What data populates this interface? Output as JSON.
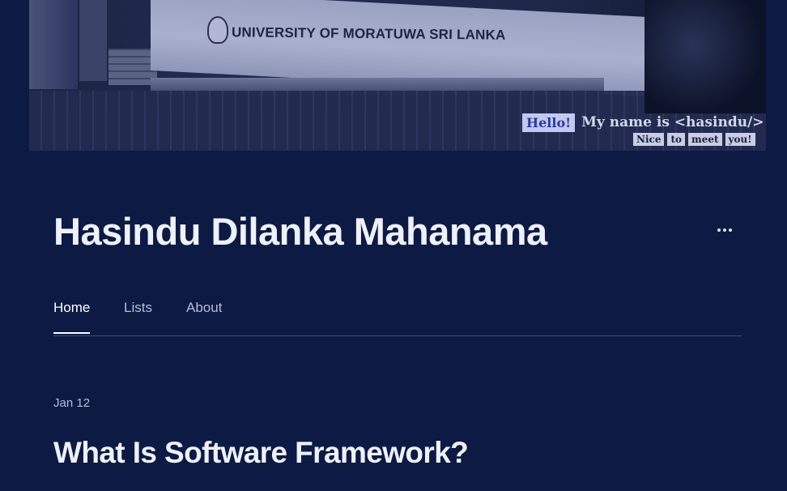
{
  "banner": {
    "university_text": "UNIVERSITY OF MORATUWA SRI LANKA",
    "hello_tag": "Hello!",
    "intro_text": "My name is <hasindu/>",
    "greeting_words": [
      "Nice",
      "to",
      "meet",
      "you!"
    ]
  },
  "profile": {
    "name": "Hasindu Dilanka Mahanama",
    "more_icon": "ellipsis-icon"
  },
  "tabs": [
    {
      "label": "Home",
      "active": true
    },
    {
      "label": "Lists",
      "active": false
    },
    {
      "label": "About",
      "active": false
    }
  ],
  "post": {
    "date": "Jan 12",
    "title": "What Is Software Framework?"
  }
}
